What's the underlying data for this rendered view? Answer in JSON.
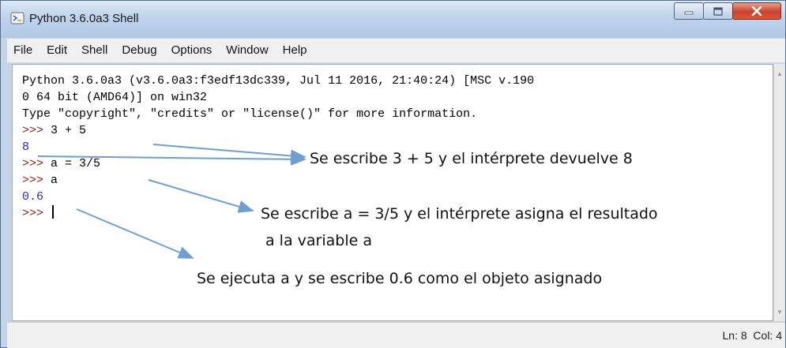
{
  "window": {
    "title": "Python 3.6.0a3 Shell",
    "icon": "python-idle-icon",
    "controls": [
      "minimize-icon",
      "maximize-icon",
      "close-icon"
    ]
  },
  "menu": [
    "File",
    "Edit",
    "Shell",
    "Debug",
    "Options",
    "Window",
    "Help"
  ],
  "shell": {
    "banner": [
      "Python 3.6.0a3 (v3.6.0a3:f3edf13dc339, Jul 11 2016, 21:40:24) [MSC v.190",
      "0 64 bit (AMD64)] on win32",
      "Type \"copyright\", \"credits\" or \"license()\" for more information."
    ],
    "prompt": ">>>",
    "entries": [
      {
        "input": " 3 + 5",
        "output": "8"
      },
      {
        "input": " a = 3/5",
        "output": null
      },
      {
        "input": " a",
        "output": "0.6"
      }
    ]
  },
  "annotations": {
    "sum": "Se escribe 3 + 5 y el intérprete devuelve 8",
    "assign_line1": "Se escribe a = 3/5 y el intérprete asigna el resultado",
    "assign_line2": "a la variable a",
    "exec": "Se ejecuta a y se escribe 0.6 como el objeto asignado"
  },
  "status": {
    "line": "Ln: 8",
    "col": "Col: 4"
  },
  "colors": {
    "prompt": "#8b1c10",
    "output": "#2a2ac8",
    "arrow": "#6f9fd0"
  }
}
